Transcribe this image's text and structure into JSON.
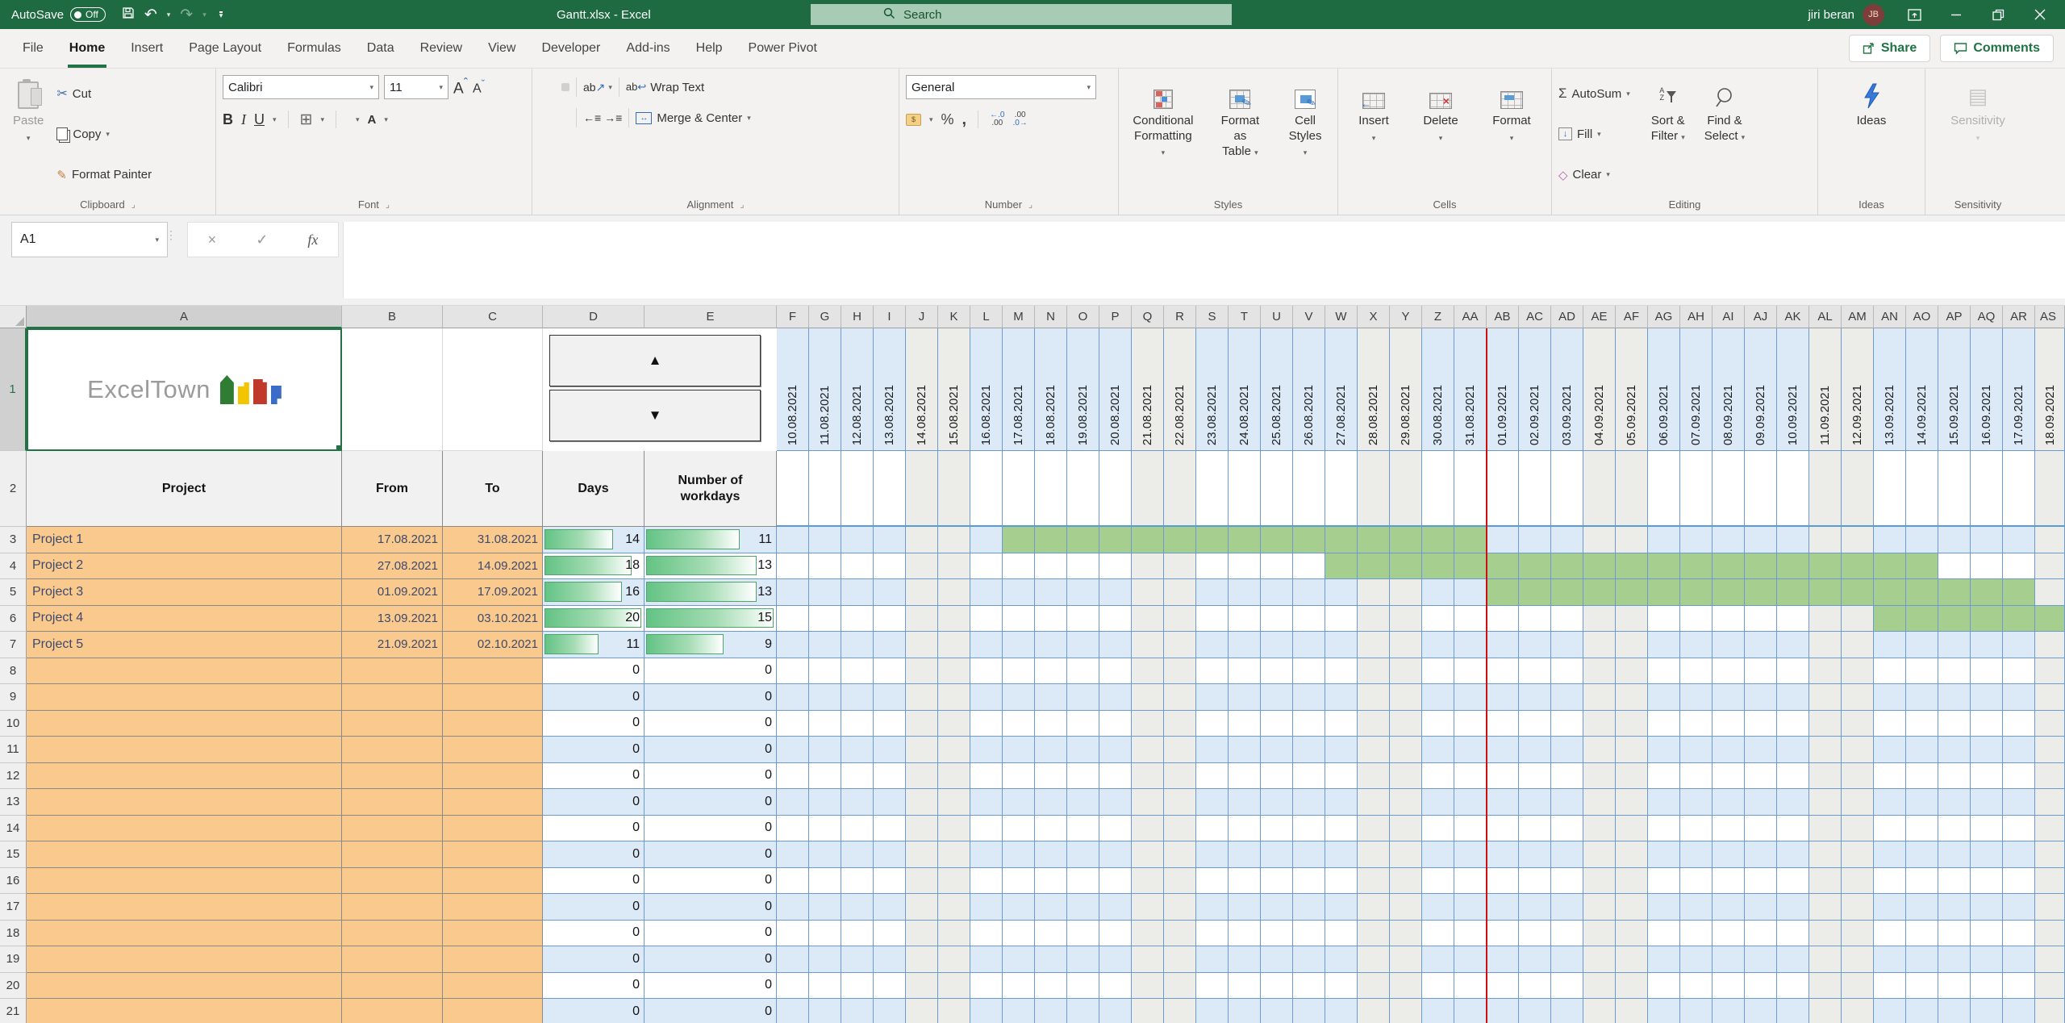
{
  "titlebar": {
    "autosave_label": "AutoSave",
    "autosave_state": "Off",
    "title": "Gantt.xlsx - Excel",
    "search_placeholder": "Search",
    "user_name": "jiri beran",
    "user_initials": "JB"
  },
  "tabs": {
    "items": [
      "File",
      "Home",
      "Insert",
      "Page Layout",
      "Formulas",
      "Data",
      "Review",
      "View",
      "Developer",
      "Add-ins",
      "Help",
      "Power Pivot"
    ],
    "active": "Home",
    "share": "Share",
    "comments": "Comments"
  },
  "ribbon": {
    "clipboard": {
      "label": "Clipboard",
      "paste": "Paste",
      "cut": "Cut",
      "copy": "Copy",
      "format_painter": "Format Painter"
    },
    "font": {
      "label": "Font",
      "family": "Calibri",
      "size": "11"
    },
    "alignment": {
      "label": "Alignment",
      "wrap": "Wrap Text",
      "merge": "Merge & Center"
    },
    "number": {
      "label": "Number",
      "format": "General"
    },
    "styles": {
      "label": "Styles",
      "conditional_1": "Conditional",
      "conditional_2": "Formatting",
      "format_table_1": "Format as",
      "format_table_2": "Table",
      "cell_styles_1": "Cell",
      "cell_styles_2": "Styles"
    },
    "cells": {
      "label": "Cells",
      "insert": "Insert",
      "delete": "Delete",
      "format": "Format"
    },
    "editing": {
      "label": "Editing",
      "autosum": "AutoSum",
      "fill": "Fill",
      "clear": "Clear",
      "sort_1": "Sort &",
      "sort_2": "Filter",
      "find_1": "Find &",
      "find_2": "Select"
    },
    "ideas": {
      "label": "Ideas",
      "button": "Ideas"
    },
    "sensitivity": {
      "label": "Sensitivity",
      "button": "Sensitivity"
    }
  },
  "formula_bar": {
    "name_box": "A1",
    "fx_label": "fx"
  },
  "icons": {
    "spinner_up": "▲",
    "spinner_down": "▼",
    "undo": "↶",
    "redo": "↷",
    "cut": "✂",
    "autosum": "Σ",
    "percent": "%",
    "comma": ",",
    "bold": "B",
    "italic": "I",
    "underline": "U",
    "borders": "⊞",
    "check": "✓",
    "cancel": "×",
    "fill_down": "↓",
    "clear": "◇",
    "font_letter": "A",
    "grow_caret": "ˆ",
    "shrink_caret": "ˇ",
    "orientation_text": "ab",
    "orientation_arrow": "↗",
    "wrap_text_icon": "ab",
    "wrap_arrow": "↩",
    "merge_arrow": "↔",
    "align_sample": "≡",
    "indent_dec": "←≡",
    "indent_inc": "→≡",
    "money": "$",
    "inc_dec_top": "←.0",
    "inc_dec_bot": ".00",
    "dec_dec_top": ".00",
    "dec_dec_bot": ".0→",
    "az_a": "A",
    "az_z": "Z",
    "sensitivity_doc": "▤"
  },
  "sheet": {
    "logo_text": "ExcelTown",
    "selected_row": "1",
    "left_col_letters": [
      "A",
      "B",
      "C",
      "D",
      "E"
    ],
    "table_headers": [
      "Project",
      "From",
      "To",
      "Days",
      "Number of workdays"
    ],
    "date_col_letters": [
      "F",
      "G",
      "H",
      "I",
      "J",
      "K",
      "L",
      "M",
      "N",
      "O",
      "P",
      "Q",
      "R",
      "S",
      "T",
      "U",
      "V",
      "W",
      "X",
      "Y",
      "Z",
      "AA",
      "AB",
      "AC",
      "AD",
      "AE",
      "AF",
      "AG",
      "AH",
      "AI",
      "AJ",
      "AK",
      "AL",
      "AM",
      "AN",
      "AO",
      "AP",
      "AQ",
      "AR",
      "AS"
    ],
    "dates": [
      "10.08.2021",
      "11.08.2021",
      "12.08.2021",
      "13.08.2021",
      "14.08.2021",
      "15.08.2021",
      "16.08.2021",
      "17.08.2021",
      "18.08.2021",
      "19.08.2021",
      "20.08.2021",
      "21.08.2021",
      "22.08.2021",
      "23.08.2021",
      "24.08.2021",
      "25.08.2021",
      "26.08.2021",
      "27.08.2021",
      "28.08.2021",
      "29.08.2021",
      "30.08.2021",
      "31.08.2021",
      "01.09.2021",
      "02.09.2021",
      "03.09.2021",
      "04.09.2021",
      "05.09.2021",
      "06.09.2021",
      "07.09.2021",
      "08.09.2021",
      "09.09.2021",
      "10.09.2021",
      "11.09.2021",
      "12.09.2021",
      "13.09.2021",
      "14.09.2021",
      "15.09.2021",
      "16.09.2021",
      "17.09.2021",
      "18.09.2021"
    ],
    "weekend_indices": [
      4,
      5,
      11,
      12,
      18,
      19,
      25,
      26,
      32,
      33,
      39
    ],
    "today_after_index": 21,
    "projects": [
      {
        "row": 3,
        "name": "Project 1",
        "from": "17.08.2021",
        "to": "31.08.2021",
        "days": 14,
        "workdays": 11
      },
      {
        "row": 4,
        "name": "Project 2",
        "from": "27.08.2021",
        "to": "14.09.2021",
        "days": 18,
        "workdays": 13
      },
      {
        "row": 5,
        "name": "Project 3",
        "from": "01.09.2021",
        "to": "17.09.2021",
        "days": 16,
        "workdays": 13
      },
      {
        "row": 6,
        "name": "Project 4",
        "from": "13.09.2021",
        "to": "03.10.2021",
        "days": 20,
        "workdays": 15
      },
      {
        "row": 7,
        "name": "Project 5",
        "from": "21.09.2021",
        "to": "02.10.2021",
        "days": 11,
        "workdays": 9
      }
    ],
    "gantt_bars": [
      {
        "row": 3,
        "start": 7,
        "end": 21
      },
      {
        "row": 4,
        "start": 17,
        "end": 35
      },
      {
        "row": 5,
        "start": 22,
        "end": 38
      },
      {
        "row": 6,
        "start": 34,
        "end": 39
      }
    ],
    "empty_rows_value": "0",
    "first_row": 3,
    "last_row": 21,
    "days_scale_max": 20,
    "workdays_scale_max": 15
  },
  "colors": {
    "titlebar_green": "#1e6b41",
    "accent_green": "#217346",
    "gantt_green": "#a6ce8f",
    "row_blue": "#dce9f7",
    "weekend_gray": "#ecece9",
    "orange_fill": "#f9c98e",
    "grid_blue_border": "#6b9bd2",
    "today_red": "#cc1111",
    "databar_green": "#63c384"
  }
}
